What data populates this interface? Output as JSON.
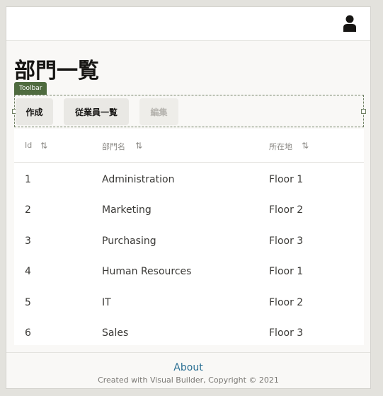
{
  "header": {
    "user_icon": "user-icon"
  },
  "page": {
    "title": "部門一覧"
  },
  "toolbar": {
    "tag": "Toolbar",
    "buttons": [
      {
        "label": "作成",
        "enabled": true
      },
      {
        "label": "従業員一覧",
        "enabled": true
      },
      {
        "label": "編集",
        "enabled": false
      }
    ]
  },
  "table": {
    "columns": [
      "Id",
      "部門名",
      "所在地"
    ],
    "sort_icon": "sort-icon",
    "rows": [
      [
        "1",
        "Administration",
        "Floor 1"
      ],
      [
        "2",
        "Marketing",
        "Floor 2"
      ],
      [
        "3",
        "Purchasing",
        "Floor 3"
      ],
      [
        "4",
        "Human Resources",
        "Floor 1"
      ],
      [
        "5",
        "IT",
        "Floor 2"
      ],
      [
        "6",
        "Sales",
        "Floor 3"
      ]
    ]
  },
  "footer": {
    "about": "About",
    "copyright": "Created with Visual Builder, Copyright © 2021"
  }
}
